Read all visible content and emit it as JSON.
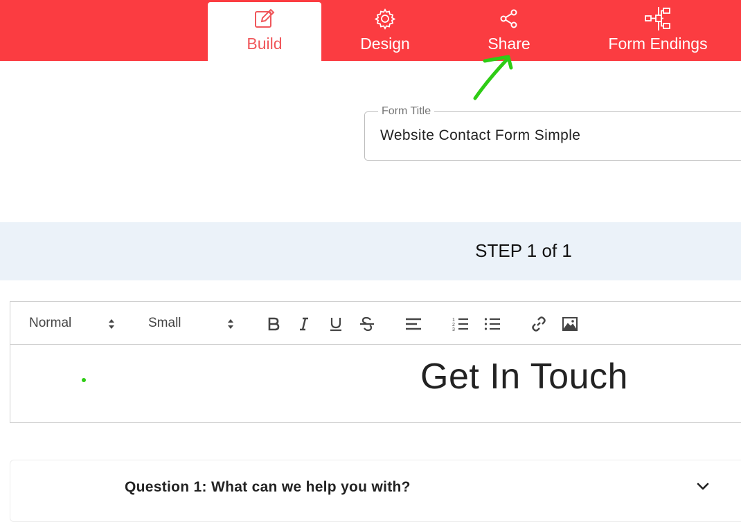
{
  "nav": {
    "tabs": [
      {
        "label": "Build",
        "icon": "pencil-square-icon",
        "active": true
      },
      {
        "label": "Design",
        "icon": "gear-icon",
        "active": false
      },
      {
        "label": "Share",
        "icon": "share-icon",
        "active": false
      },
      {
        "label": "Form Endings",
        "icon": "sitemap-icon",
        "active": false
      }
    ],
    "colors": {
      "bar": "#fb3c41",
      "active_text": "#f0575b",
      "annotation": "#2ecc15"
    }
  },
  "form_title": {
    "legend": "Form Title",
    "value": "Website Contact Form Simple"
  },
  "step": {
    "label": "STEP 1 of 1"
  },
  "editor": {
    "toolbar": {
      "block_format": "Normal",
      "font_size": "Small",
      "buttons": [
        "bold-icon",
        "italic-icon",
        "underline-icon",
        "strikethrough-icon",
        "align-left-icon",
        "ordered-list-icon",
        "bullet-list-icon",
        "link-icon",
        "image-icon"
      ]
    },
    "content": "Get In Touch"
  },
  "questions": [
    {
      "label": "Question 1: What can we help you with?"
    }
  ]
}
